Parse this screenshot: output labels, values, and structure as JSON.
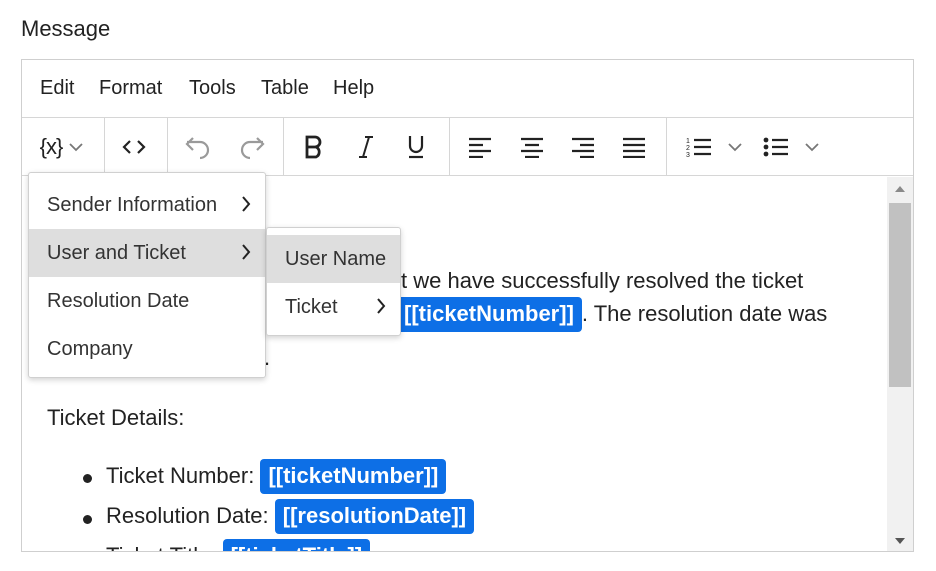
{
  "field_label": "Message",
  "menubar": {
    "items": [
      "Edit",
      "Format",
      "Tools",
      "Table",
      "Help"
    ]
  },
  "toolbar": {
    "variables_label": "{x}",
    "icons": [
      "variables-icon",
      "chevron-down-icon",
      "code-view-icon",
      "undo-icon",
      "redo-icon",
      "bold-icon",
      "italic-icon",
      "underline-icon",
      "align-left-icon",
      "align-center-icon",
      "align-right-icon",
      "justify-icon",
      "numbered-list-icon",
      "bulleted-list-icon"
    ]
  },
  "content": {
    "para_fragment_1": "t we have successfully resolved the ticket",
    "para_tag_1": "[[ticketNumber]]",
    "para_fragment_2": ". The resolution date was",
    "para_fragment_3": ".",
    "details_heading": "Ticket Details:",
    "list": [
      {
        "label": "Ticket Number:",
        "tag": "[[ticketNumber]]"
      },
      {
        "label": "Resolution Date:",
        "tag": "[[resolutionDate]]"
      },
      {
        "label": "Ticket Title:",
        "tag": "[[ticketTitle]]"
      }
    ]
  },
  "dropdown": {
    "items": [
      "Sender Information",
      "User and Ticket",
      "Resolution Date",
      "Company"
    ],
    "active_index": 1
  },
  "submenu": {
    "items": [
      "User Name",
      "Ticket"
    ],
    "active_index": 0
  },
  "colors": {
    "tag_background": "#0d6fe6",
    "tag_text": "#ffffff",
    "active_item": "#dedede"
  }
}
